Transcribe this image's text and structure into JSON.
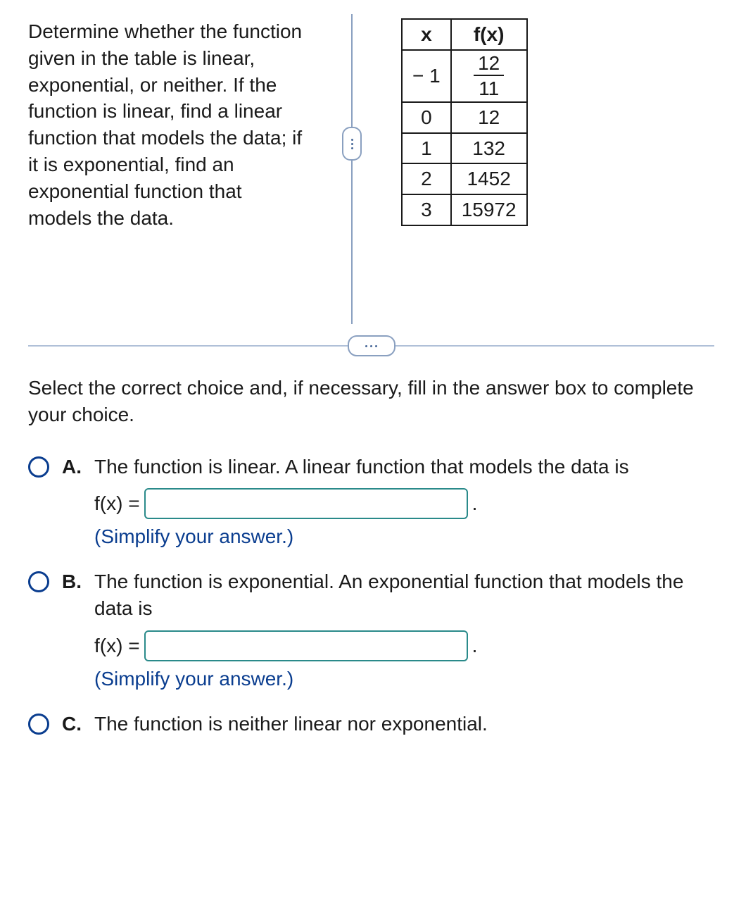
{
  "question": {
    "prompt": "Determine whether the function given in the table is linear, exponential, or neither. If the function is linear, find a linear function that models the data; if it is exponential, find an exponential function that models the data."
  },
  "table": {
    "headers": {
      "x": "x",
      "fx": "f(x)"
    },
    "rows": [
      {
        "x": "− 1",
        "fx_num": "12",
        "fx_den": "11"
      },
      {
        "x": "0",
        "fx": "12"
      },
      {
        "x": "1",
        "fx": "132"
      },
      {
        "x": "2",
        "fx": "1452"
      },
      {
        "x": "3",
        "fx": "15972"
      }
    ]
  },
  "sub_prompt": "Select the correct choice and, if necessary, fill in the answer box to complete your choice.",
  "choices": {
    "A": {
      "letter": "A.",
      "text": "The function is linear. A linear function that models the data is",
      "fx_label": "f(x) =",
      "period": ".",
      "hint": "(Simplify your answer.)",
      "input": ""
    },
    "B": {
      "letter": "B.",
      "text": "The function is exponential. An exponential function that models the data is",
      "fx_label": "f(x) =",
      "period": ".",
      "hint": "(Simplify your answer.)",
      "input": ""
    },
    "C": {
      "letter": "C.",
      "text": "The function is neither linear nor exponential."
    }
  },
  "chart_data": {
    "type": "table",
    "title": "Function values",
    "columns": [
      "x",
      "f(x)"
    ],
    "rows": [
      [
        -1,
        "12/11"
      ],
      [
        0,
        12
      ],
      [
        1,
        132
      ],
      [
        2,
        1452
      ],
      [
        3,
        15972
      ]
    ]
  }
}
